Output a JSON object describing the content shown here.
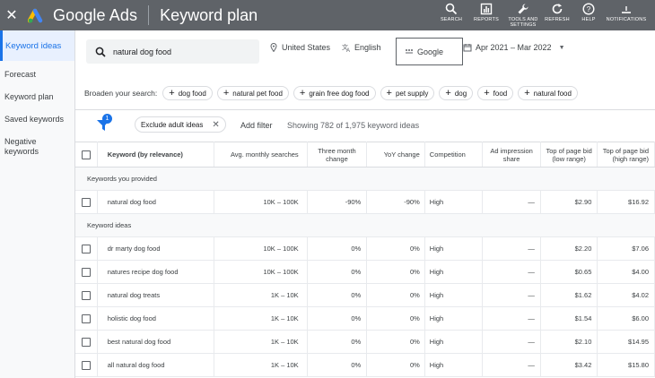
{
  "topbar": {
    "brand": "Google Ads",
    "page_title": "Keyword plan",
    "tools": [
      {
        "label": "SEARCH",
        "icon": "search-icon"
      },
      {
        "label": "REPORTS",
        "icon": "reports-icon"
      },
      {
        "label": "TOOLS AND SETTINGS",
        "icon": "wrench-icon"
      },
      {
        "label": "REFRESH",
        "icon": "refresh-icon"
      },
      {
        "label": "HELP",
        "icon": "help-icon"
      },
      {
        "label": "NOTIFICATIONS",
        "icon": "bell-icon"
      }
    ]
  },
  "sidebar": {
    "items": [
      {
        "label": "Keyword ideas"
      },
      {
        "label": "Forecast"
      },
      {
        "label": "Keyword plan"
      },
      {
        "label": "Saved keywords"
      },
      {
        "label": "Negative keywords"
      }
    ]
  },
  "search": {
    "value": "natural dog food",
    "location": "United States",
    "language": "English",
    "network": "Google",
    "date_range": "Apr 2021 – Mar 2022"
  },
  "broaden": {
    "label": "Broaden your search:",
    "chips": [
      "dog food",
      "natural pet food",
      "grain free dog food",
      "pet supply",
      "dog",
      "food",
      "natural food"
    ]
  },
  "filters": {
    "badge_count": "1",
    "exclude_chip": "Exclude adult ideas",
    "add_filter": "Add filter",
    "showing": "Showing 782 of 1,975 keyword ideas"
  },
  "table": {
    "headers": {
      "keyword": "Keyword (by relevance)",
      "avg": "Avg. monthly searches",
      "three_month": "Three month change",
      "yoy": "YoY change",
      "competition": "Competition",
      "impression": "Ad impression share",
      "low_bid": "Top of page bid (low range)",
      "high_bid": "Top of page bid (high range)"
    },
    "section_provided": "Keywords you provided",
    "provided_row": {
      "keyword": "natural dog food",
      "avg": "10K – 100K",
      "three_month": "-90%",
      "yoy": "-90%",
      "competition": "High",
      "impression": "—",
      "low_bid": "$2.90",
      "high_bid": "$16.92"
    },
    "section_ideas": "Keyword ideas",
    "idea_rows": [
      {
        "keyword": "dr marty dog food",
        "avg": "10K – 100K",
        "three_month": "0%",
        "yoy": "0%",
        "competition": "High",
        "impression": "—",
        "low_bid": "$2.20",
        "high_bid": "$7.06"
      },
      {
        "keyword": "natures recipe dog food",
        "avg": "10K – 100K",
        "three_month": "0%",
        "yoy": "0%",
        "competition": "High",
        "impression": "—",
        "low_bid": "$0.65",
        "high_bid": "$4.00"
      },
      {
        "keyword": "natural dog treats",
        "avg": "1K – 10K",
        "three_month": "0%",
        "yoy": "0%",
        "competition": "High",
        "impression": "—",
        "low_bid": "$1.62",
        "high_bid": "$4.02"
      },
      {
        "keyword": "holistic dog food",
        "avg": "1K – 10K",
        "three_month": "0%",
        "yoy": "0%",
        "competition": "High",
        "impression": "—",
        "low_bid": "$1.54",
        "high_bid": "$6.00"
      },
      {
        "keyword": "best natural dog food",
        "avg": "1K – 10K",
        "three_month": "0%",
        "yoy": "0%",
        "competition": "High",
        "impression": "—",
        "low_bid": "$2.10",
        "high_bid": "$14.95"
      },
      {
        "keyword": "all natural dog food",
        "avg": "1K – 10K",
        "three_month": "0%",
        "yoy": "0%",
        "competition": "High",
        "impression": "—",
        "low_bid": "$3.42",
        "high_bid": "$15.80"
      }
    ]
  }
}
